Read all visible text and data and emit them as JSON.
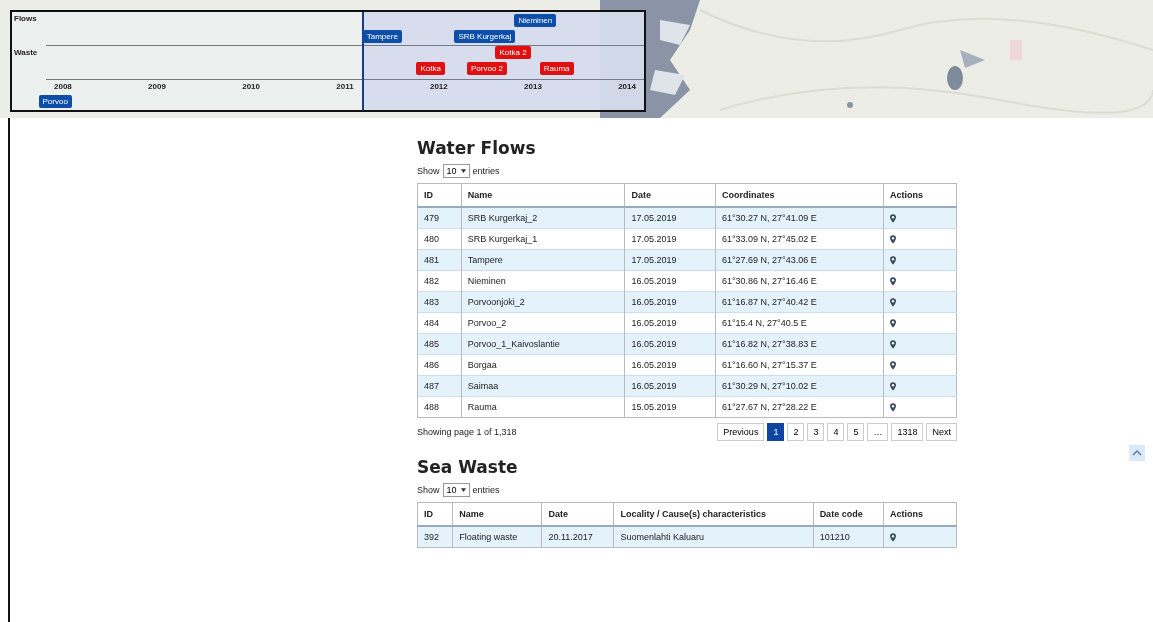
{
  "timeline": {
    "rows": [
      "Flows",
      "Waste"
    ],
    "axis": [
      "2008",
      "2009",
      "2010",
      "2011",
      "2012",
      "2013",
      "2014"
    ],
    "events": [
      {
        "label": "Nieminen",
        "kind": "flow"
      },
      {
        "label": "Tampere",
        "kind": "flow"
      },
      {
        "label": "SRB Kurgerkaj",
        "kind": "flow"
      },
      {
        "label": "Kotka 2",
        "kind": "waste"
      },
      {
        "label": "Kotka",
        "kind": "waste"
      },
      {
        "label": "Porvoo 2",
        "kind": "waste"
      },
      {
        "label": "Rauma",
        "kind": "waste"
      },
      {
        "label": "Porvoo",
        "kind": "flow"
      }
    ]
  },
  "sections": [
    {
      "title": "Water Flows",
      "show_label": "Show",
      "page_size": "10",
      "entries_label": "entries",
      "columns": [
        "ID",
        "Name",
        "Date",
        "Coordinates",
        "Actions"
      ],
      "rows": [
        [
          "479",
          "SRB Kurgerkaj_2",
          "17.05.2019",
          "61°30.27 N, 27°41.09 E"
        ],
        [
          "480",
          "SRB Kurgerkaj_1",
          "17.05.2019",
          "61°33.09 N, 27°45.02 E"
        ],
        [
          "481",
          "Tampere",
          "17.05.2019",
          "61°27.69 N, 27°43.06 E"
        ],
        [
          "482",
          "Nieminen",
          "16.05.2019",
          "61°30.86 N, 27°16.46 E"
        ],
        [
          "483",
          "Porvoonjoki_2",
          "16.05.2019",
          "61°16.87 N, 27°40.42 E"
        ],
        [
          "484",
          "Porvoo_2",
          "16.05.2019",
          "61°15.4 N, 27°40.5 E"
        ],
        [
          "485",
          "Porvoo_1_Kaivoslantie",
          "16.05.2019",
          "61°16.82 N, 27°38.83 E"
        ],
        [
          "486",
          "Borgaa",
          "16.05.2019",
          "61°16.60 N, 27°15.37 E"
        ],
        [
          "487",
          "Saimaa",
          "16.05.2019",
          "61°30.29 N, 27°10.02 E"
        ],
        [
          "488",
          "Rauma",
          "15.05.2019",
          "61°27.67 N, 27°28.22 E"
        ]
      ],
      "footer": {
        "info": "Showing page 1 of 1,318",
        "pages": [
          {
            "label": "Previous",
            "selected": false
          },
          {
            "label": "1",
            "selected": true
          },
          {
            "label": "2",
            "selected": false
          },
          {
            "label": "3",
            "selected": false
          },
          {
            "label": "4",
            "selected": false
          },
          {
            "label": "5",
            "selected": false
          },
          {
            "label": "…",
            "selected": false
          },
          {
            "label": "1318",
            "selected": false
          },
          {
            "label": "Next",
            "selected": false
          }
        ]
      }
    },
    {
      "title": "Sea Waste",
      "show_label": "Show",
      "page_size": "10",
      "entries_label": "entries",
      "columns": [
        "ID",
        "Name",
        "Date",
        "Locality / Cause(s) characteristics",
        "Date code",
        "Actions"
      ],
      "rows": [
        [
          "392",
          "Floating waste",
          "20.11.2017",
          "Suomenlahti Kaluaru",
          "101210"
        ]
      ]
    }
  ]
}
